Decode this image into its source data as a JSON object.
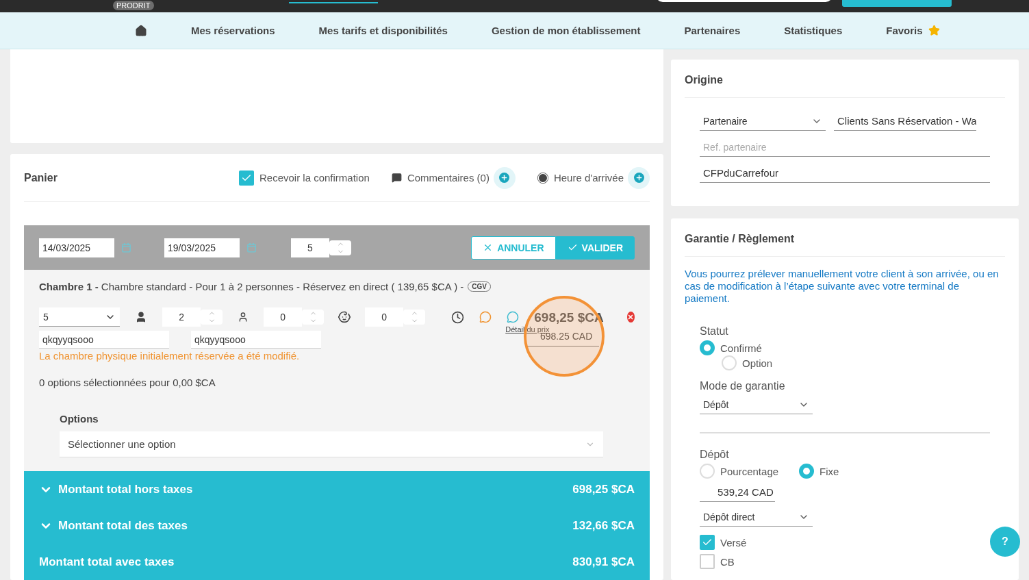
{
  "top_bar": {
    "badge": "PRODRIT"
  },
  "nav": {
    "items": [
      {
        "kind": "home"
      },
      {
        "kind": "link",
        "label": "Mes réservations"
      },
      {
        "kind": "link",
        "label": "Mes tarifs et disponibilités"
      },
      {
        "kind": "link",
        "label": "Gestion de mon établissement"
      },
      {
        "kind": "link",
        "label": "Partenaires"
      },
      {
        "kind": "link",
        "label": "Statistiques"
      },
      {
        "kind": "favorite",
        "label": "Favoris"
      }
    ]
  },
  "panier": {
    "title": "Panier",
    "confirmation": {
      "label": "Recevoir la confirmation",
      "checked": true
    },
    "comments": {
      "label": "Commentaires (0)"
    },
    "arrival": {
      "label": "Heure d'arrivée"
    },
    "edit_bar": {
      "start_date": "14/03/2025",
      "end_date": "19/03/2025",
      "nights": "5",
      "cancel": "ANNULER",
      "validate": "VALIDER"
    },
    "room": {
      "description": "**Chambre 1 -** Chambre standard - Pour 1 à 2 personnes - Réservez en direct ( 139,65 $CA ) -",
      "badge": "CGV",
      "room_number": "5",
      "adults": "2",
      "children": "0",
      "babies": "0",
      "price": "698,25 $CA",
      "price_detail": "Détail du prix",
      "price_input": "698.25 CAD",
      "names": [
        "qkqyyqsooo",
        "qkqyyqsooo"
      ],
      "warning": "La chambre physique initialement réservée a été modifié.",
      "options_summary": "0 options sélectionnées pour 0,00 $CA",
      "options_label": "Options",
      "options_placeholder": "Sélectionner une option"
    },
    "totals": [
      {
        "kind": "expandable",
        "label": "Montant total hors taxes",
        "value": "698,25 $CA"
      },
      {
        "kind": "expandable",
        "label": "Montant total des taxes",
        "value": "132,66 $CA"
      },
      {
        "kind": "plain",
        "label": "Montant total avec taxes",
        "value": "830,91 $CA"
      }
    ]
  },
  "origine": {
    "title": "Origine",
    "partner_type": "Partenaire",
    "partner": "Clients Sans Réservation - Wa",
    "ref_placeholder": "Ref. partenaire",
    "reference": "CFPduCarrefour"
  },
  "garantie": {
    "title": "Garantie / Règlement",
    "info": "Vous pourrez prélever manuellement votre client à son arrivée, ou en cas de modification à l’étape suivante avec votre terminal de paiement.",
    "statut": {
      "label": "Statut",
      "options": [
        {
          "label": "Confirmé",
          "selected": true
        },
        {
          "label": "Option",
          "selected": false
        }
      ]
    },
    "mode": {
      "label": "Mode de garantie",
      "value": "Dépôt"
    },
    "depot": {
      "label": "Dépôt",
      "types": [
        {
          "label": "Pourcentage",
          "selected": false
        },
        {
          "label": "Fixe",
          "selected": true
        }
      ],
      "amount": "539,24 CAD",
      "method": "Dépôt direct"
    },
    "checks": [
      {
        "label": "Versé",
        "checked": true
      },
      {
        "label": "CB",
        "checked": false
      }
    ]
  },
  "help": {
    "label": "?"
  }
}
